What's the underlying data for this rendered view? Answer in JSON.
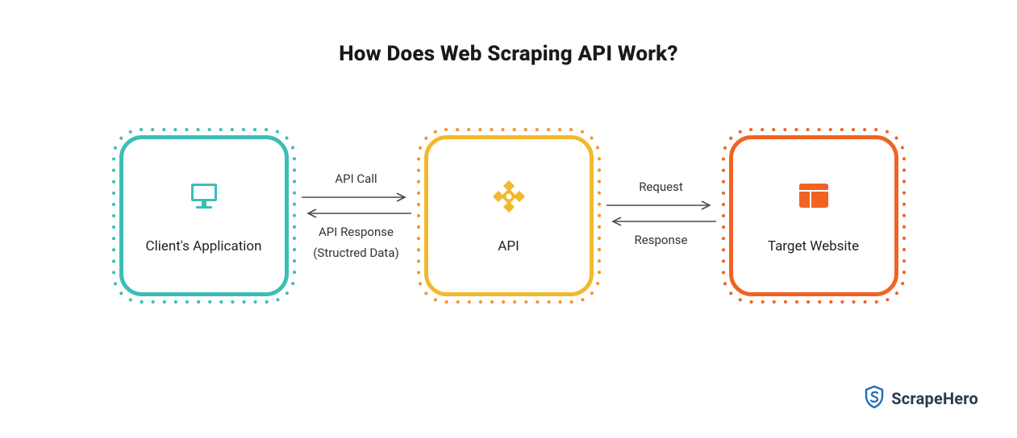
{
  "title": "How Does Web Scraping API Work?",
  "nodes": {
    "client": {
      "label": "Client's Application",
      "icon": "monitor-icon",
      "color": "#3DBDB6",
      "dot": "#3DBDB6"
    },
    "api": {
      "label": "API",
      "icon": "api-diamond-icon",
      "color": "#F2B92D",
      "dot": "#F2952D"
    },
    "target": {
      "label": "Target Website",
      "icon": "webpage-icon",
      "color": "#F06322",
      "dot": "#F06322"
    }
  },
  "edges": {
    "left": {
      "top": "API Call",
      "bottom1": "API Response",
      "bottom2": "(Structred Data)"
    },
    "right": {
      "top": "Request",
      "bottom1": "Response",
      "bottom2": ""
    }
  },
  "brand": {
    "name": "ScrapeHero",
    "color": "#1f6fb5"
  },
  "colors": {
    "arrow": "#4a4a4a"
  }
}
